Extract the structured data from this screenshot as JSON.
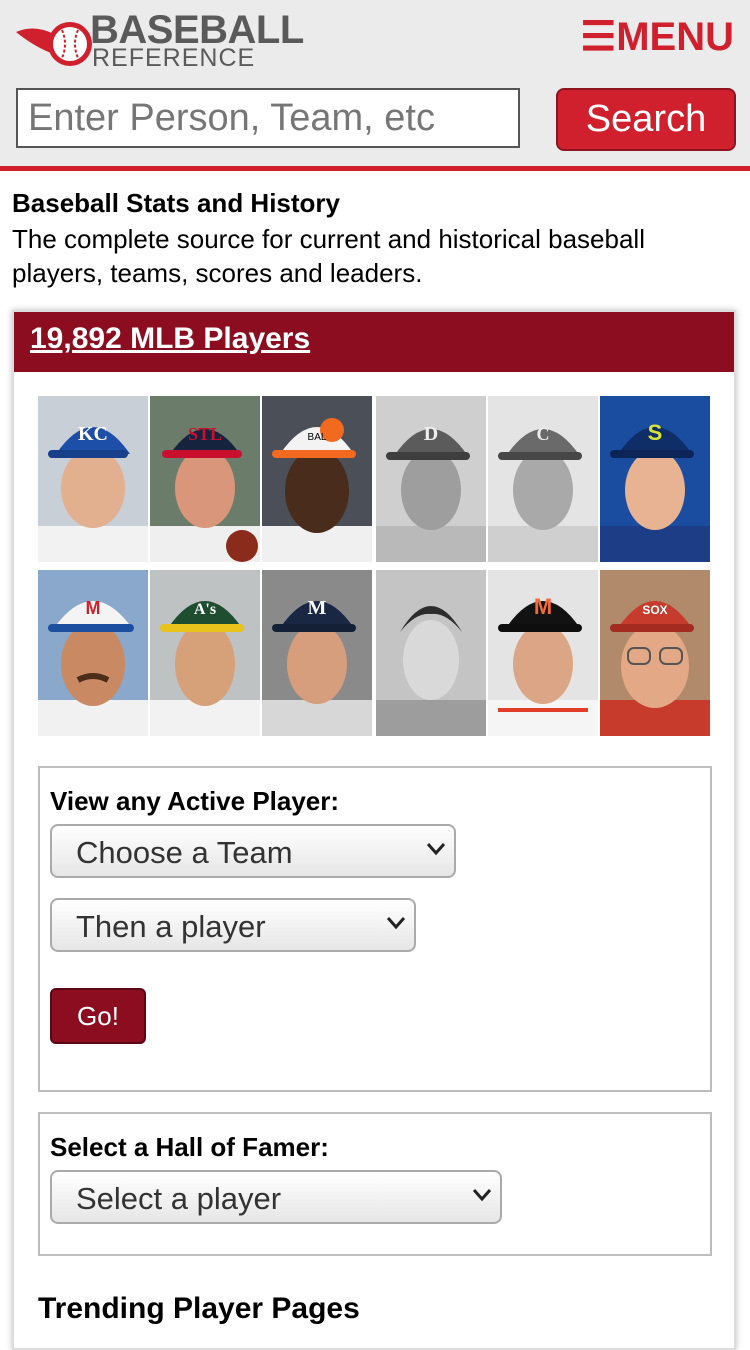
{
  "header": {
    "logo_line1": "BASEBALL",
    "logo_line2": "REFERENCE",
    "menu_label": "☰MENU",
    "search_placeholder": "Enter Person, Team, etc",
    "search_button": "Search"
  },
  "intro": {
    "title": "Baseball Stats and History",
    "description": "The complete source for current and historical baseball players, teams, scores and leaders."
  },
  "players_card": {
    "title": "19,892 MLB Players",
    "photos": [
      {
        "cap": "KC"
      },
      {
        "cap": "STL"
      },
      {
        "cap": "BAL"
      },
      {
        "cap": "D"
      },
      {
        "cap": "C"
      },
      {
        "cap": "S"
      },
      {
        "cap": "M"
      },
      {
        "cap": "A's"
      },
      {
        "cap": "M"
      },
      {
        "cap": ""
      },
      {
        "cap": "M"
      },
      {
        "cap": "SOX"
      }
    ]
  },
  "active_player": {
    "label": "View any Active Player:",
    "team_select": "Choose a Team",
    "player_select": "Then a player",
    "go_button": "Go!"
  },
  "hall_of_fame": {
    "label": "Select a Hall of Famer:",
    "player_select": "Select a player"
  },
  "trending": {
    "title": "Trending Player Pages"
  },
  "colors": {
    "brand_red": "#d0202e",
    "card_header": "#8b0d1f",
    "header_bg": "#ebebeb"
  }
}
